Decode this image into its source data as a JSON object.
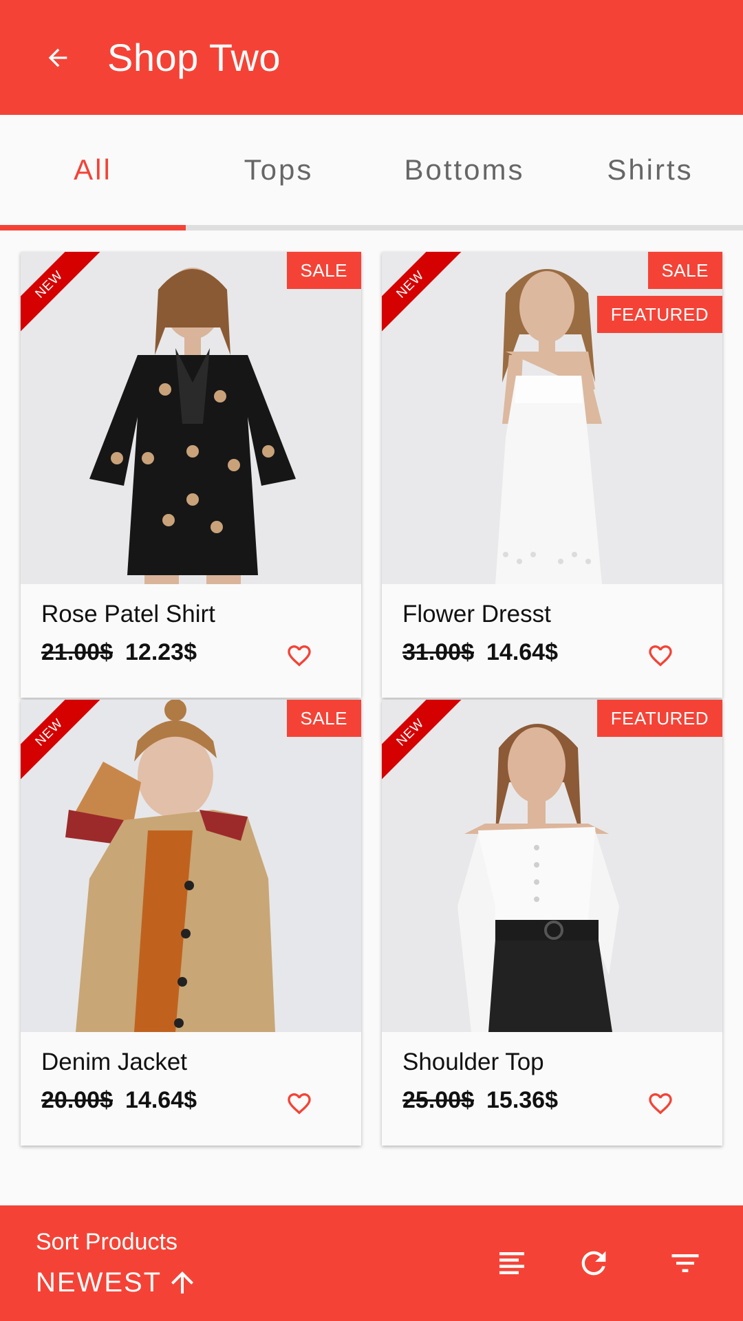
{
  "appbar": {
    "title": "Shop Two",
    "back_icon": "arrow-back-icon"
  },
  "tabs": [
    {
      "label": "All",
      "active": true
    },
    {
      "label": "Tops",
      "active": false
    },
    {
      "label": "Bottoms",
      "active": false
    },
    {
      "label": "Shirts",
      "active": false
    }
  ],
  "colors": {
    "primary": "#f44336",
    "ribbon": "#d50000"
  },
  "products": [
    {
      "name": "Rose Patel Shirt",
      "old_price": "21.00$",
      "price": "12.23$",
      "ribbon": "NEW",
      "badges": [
        "SALE"
      ]
    },
    {
      "name": "Flower Dresst",
      "old_price": "31.00$",
      "price": "14.64$",
      "ribbon": "NEW",
      "badges": [
        "SALE",
        "FEATURED"
      ]
    },
    {
      "name": "Denim Jacket",
      "old_price": "20.00$",
      "price": "14.64$",
      "ribbon": "NEW",
      "badges": [
        "SALE"
      ]
    },
    {
      "name": "Shoulder Top",
      "old_price": "25.00$",
      "price": "15.36$",
      "ribbon": "NEW",
      "badges": [
        "FEATURED"
      ]
    }
  ],
  "bottom_bar": {
    "sort_label": "Sort Products",
    "sort_value": "NEWEST",
    "icons": [
      "sort-lines-icon",
      "refresh-icon",
      "filter-icon"
    ]
  }
}
